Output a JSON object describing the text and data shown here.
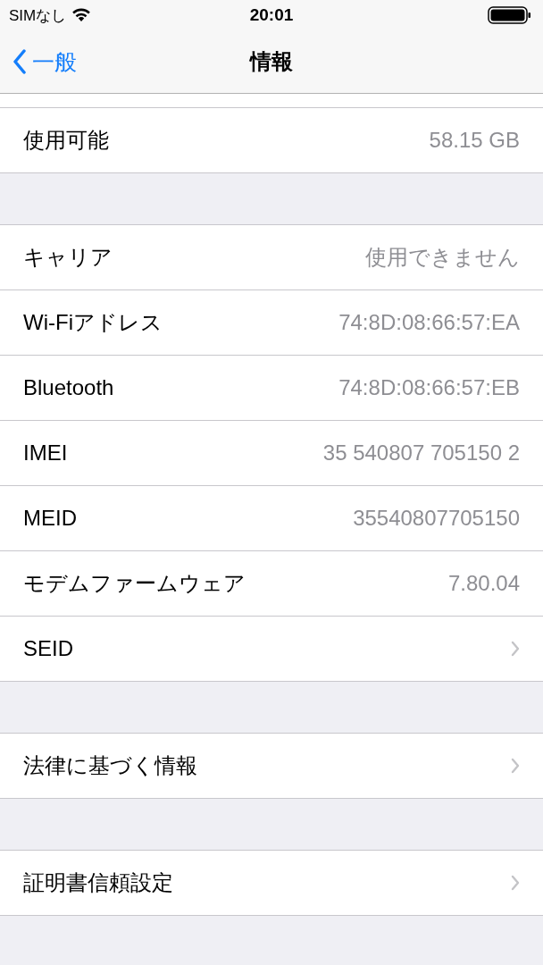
{
  "status_bar": {
    "carrier": "SIMなし",
    "time": "20:01"
  },
  "nav_bar": {
    "back": "一般",
    "title": "情報"
  },
  "groups": [
    {
      "rows": [
        {
          "kind": "value",
          "label": "使用可能",
          "value": "58.15 GB"
        }
      ],
      "partial_above": true
    },
    {
      "rows": [
        {
          "kind": "value",
          "label": "キャリア",
          "value": "使用できません"
        },
        {
          "kind": "value",
          "label": "Wi-Fiアドレス",
          "value": "74:8D:08:66:57:EA"
        },
        {
          "kind": "value",
          "label": "Bluetooth",
          "value": "74:8D:08:66:57:EB"
        },
        {
          "kind": "value",
          "label": "IMEI",
          "value": "35 540807 705150 2"
        },
        {
          "kind": "value",
          "label": "MEID",
          "value": "35540807705150"
        },
        {
          "kind": "value",
          "label": "モデムファームウェア",
          "value": "7.80.04"
        },
        {
          "kind": "disclosure",
          "label": "SEID"
        }
      ]
    },
    {
      "rows": [
        {
          "kind": "disclosure",
          "label": "法律に基づく情報"
        }
      ]
    },
    {
      "rows": [
        {
          "kind": "disclosure",
          "label": "証明書信頼設定"
        }
      ]
    }
  ]
}
